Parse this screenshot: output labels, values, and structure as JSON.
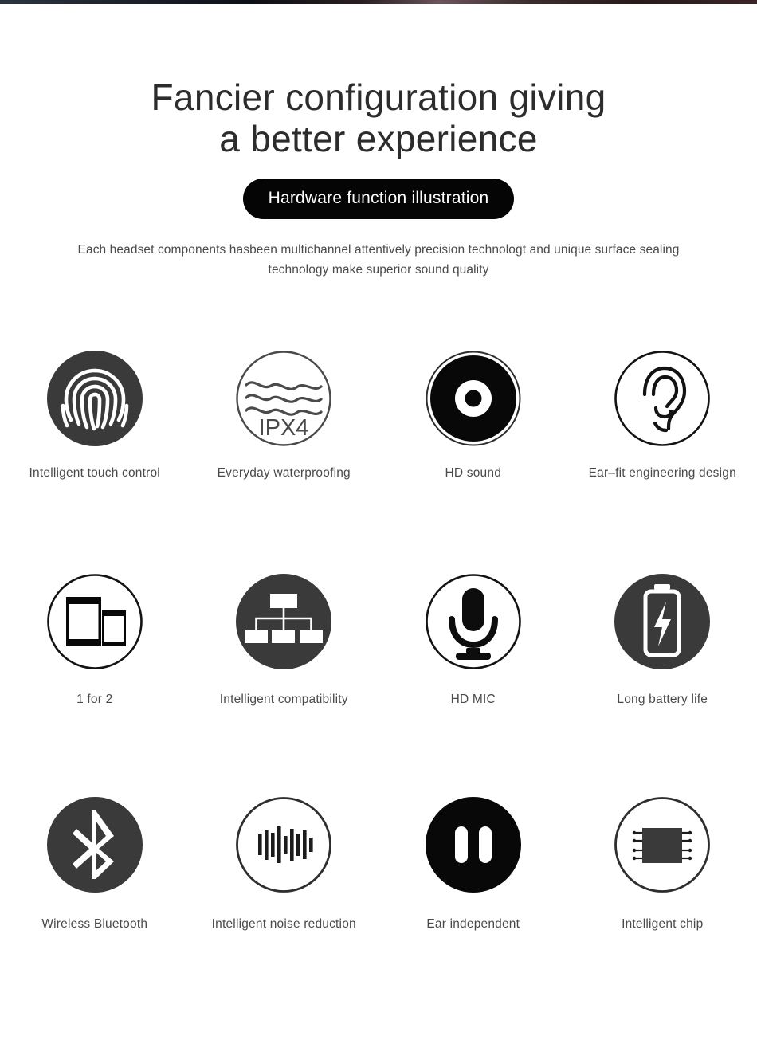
{
  "header": {
    "title_line1": "Fancier configuration giving",
    "title_line2": "a better experience",
    "badge": "Hardware function illustration",
    "subtitle": "Each headset components hasbeen multichannel attentively precision technologt and unique surface sealing technology make superior sound quality"
  },
  "colors": {
    "dark_circle": "#3a3a3a",
    "black_circle": "#080808",
    "outline": "#2e2e2e",
    "text": "#4a4a4a",
    "heading": "#2c2c2c",
    "badge_bg": "#050505",
    "badge_text": "#ffffff",
    "background": "#ffffff"
  },
  "features": [
    {
      "label": "Intelligent touch control",
      "icon": "fingerprint-icon",
      "style": "filled-dark"
    },
    {
      "label": "Everyday waterproofing",
      "icon": "water-waves-ipx4-icon",
      "style": "outline",
      "icon_text": "IPX4"
    },
    {
      "label": "HD sound",
      "icon": "speaker-disc-icon",
      "style": "filled-black"
    },
    {
      "label": "Ear-fit engineering design",
      "label_display": "Ear–fit engineering design",
      "icon": "ear-icon",
      "style": "outline"
    },
    {
      "label": "1 for 2",
      "icon": "two-phones-icon",
      "style": "outline"
    },
    {
      "label": "Intelligent compatibility",
      "icon": "hierarchy-icon",
      "style": "filled-dark"
    },
    {
      "label": "HD MIC",
      "icon": "microphone-icon",
      "style": "outline"
    },
    {
      "label": "Long battery life",
      "icon": "battery-charging-icon",
      "style": "filled-dark"
    },
    {
      "label": "Wireless Bluetooth",
      "icon": "bluetooth-icon",
      "style": "filled-dark"
    },
    {
      "label": "Intelligent noise reduction",
      "icon": "sound-wave-bars-icon",
      "style": "outline"
    },
    {
      "label": "Ear independent",
      "icon": "two-earbuds-icon",
      "style": "filled-black"
    },
    {
      "label": "Intelligent chip",
      "icon": "cpu-chip-icon",
      "style": "outline"
    }
  ]
}
